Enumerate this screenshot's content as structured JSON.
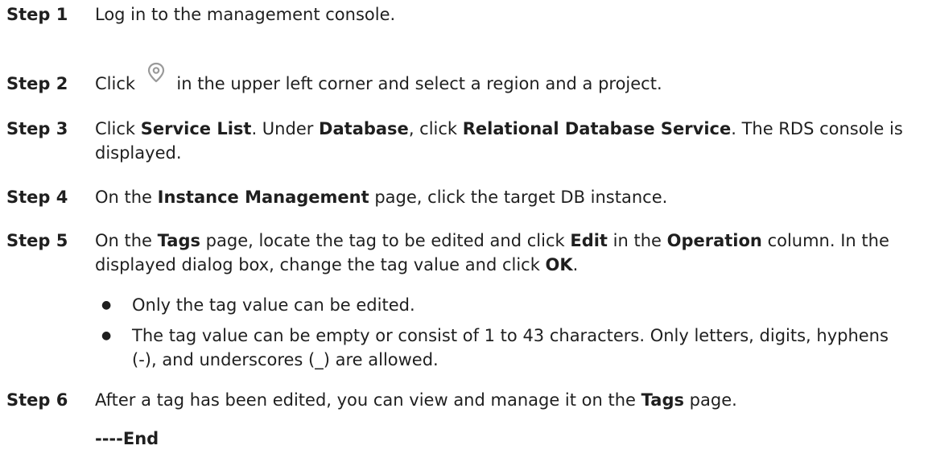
{
  "steps": [
    {
      "label": "Step 1",
      "parts": [
        "Log in to the management console."
      ]
    },
    {
      "label": "Step 2",
      "parts": [
        "Click",
        "in the upper left corner and select a region and a project."
      ],
      "icon": "location-pin-icon"
    },
    {
      "label": "Step 3",
      "parts": [
        "Click ",
        "Service List",
        ". Under ",
        "Database",
        ", click ",
        "Relational Database Service",
        ". The RDS console is displayed."
      ]
    },
    {
      "label": "Step 4",
      "parts": [
        "On the ",
        "Instance Management",
        " page, click the target DB instance."
      ]
    },
    {
      "label": "Step 5",
      "parts": [
        "On the ",
        "Tags",
        " page, locate the tag to be edited and click ",
        "Edit",
        " in the ",
        "Operation",
        " column. In the displayed dialog box, change the tag value and click ",
        "OK",
        "."
      ],
      "notes": [
        "Only the tag value can be edited.",
        "The tag value can be empty or consist of 1 to 43 characters. Only letters, digits, hyphens (-), and underscores (_) are allowed."
      ]
    },
    {
      "label": "Step 6",
      "parts": [
        "After a tag has been edited, you can view and manage it on the ",
        "Tags",
        " page."
      ]
    }
  ],
  "end_marker": "----End",
  "bullet_glyph": "●",
  "colors": {
    "text": "#1f1f1f",
    "icon": "#9a9a9a"
  }
}
